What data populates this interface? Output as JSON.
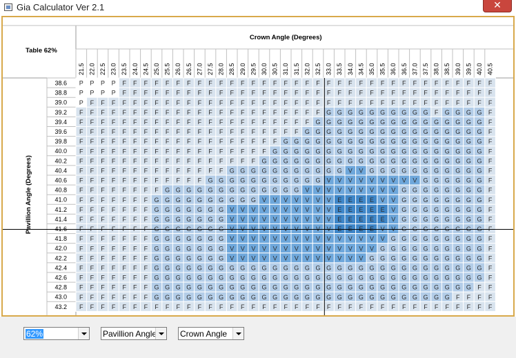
{
  "window": {
    "title": "Gia Calculator Ver 2.1",
    "close_glyph": "✕"
  },
  "table": {
    "corner_label": "Table 62%",
    "x_axis_title": "Crown Angle (Degrees)",
    "y_axis_title": "Pavillion Angle (Degrees)",
    "crown_angles": [
      "21.5",
      "22.0",
      "22.5",
      "23.0",
      "23.5",
      "24.0",
      "24.5",
      "25.0",
      "25.5",
      "26.0",
      "26.5",
      "27.0",
      "27.5",
      "28.0",
      "28.5",
      "29.0",
      "29.5",
      "30.0",
      "30.5",
      "31.0",
      "31.5",
      "32.0",
      "32.5",
      "33.0",
      "33.5",
      "34.0",
      "34.5",
      "35.0",
      "35.5",
      "36.0",
      "36.5",
      "37.0",
      "37.5",
      "38.0",
      "38.5",
      "39.0",
      "39.5",
      "40.0",
      "40.5"
    ],
    "pavilion_angles": [
      "38.6",
      "38.8",
      "39.0",
      "39.2",
      "39.4",
      "39.6",
      "39.8",
      "40.0",
      "40.2",
      "40.4",
      "40.6",
      "40.8",
      "41.0",
      "41.2",
      "41.4",
      "41.6",
      "41.8",
      "42.0",
      "42.2",
      "42.4",
      "42.6",
      "42.8",
      "43.0",
      "43.2"
    ],
    "grades": [
      "PPPPFFFFFFFFFFFFFFFFFFFFFFFFFFFFFFFFFFF",
      "PPPPFFFFFFFFFFFFFFFFFFFFFFFFFFFFFFFFFFF",
      "PFFFFFFFFFFFFFFFFFFFFFFFFFFFFFFFFFFFFFF",
      "FFFFFFFFFFFFFFFFFFFFFFFGGGGGGGGGGFGGGGF",
      "FFFFFFFFFFFFFFFFFFFFFFGGGGGGGGGGGGGGGGF",
      "FFFFFFFFFFFFFFFFFFFFFGGGGGGGGGGGGGGGGGF",
      "FFFFFFFFFFFFFFFFFFFGGGGGGGGGGGGGGGGGGGF",
      "FFFFFFFFFFFFFFFFFFGGGGGGGGGGGGGGGGGGGGF",
      "FFFFFFFFFFFFFFFFFGGGGGGGGGGGGGGGGGGGGGF",
      "FFFFFFFFFFFFFFGGGGGGGGGGGVVGGGGGGGGGGGF",
      "FFFFFFFFFFFFGGGGGGGGGGGVVVVVVVVVGGGGGGF",
      "FFFFFFFFGGGGGGGGGGGGGVVVVVVVVVGGGGGGGGF",
      "FFFFFFFGGGGGGGGGGVVVVVVVEEEEVVGGGGGGGGF",
      "FFFFFFFGGGGGGGVVVVVVVVVVEEEEEVGGGGGGGGF",
      "FFFFFFFGGGGGGGVVVVVVVVVVEEEEEVGGGGGGGGF",
      "FFFFFFFGGGGGGGVVVVVVVVVVEEEEVVGGGGGGGGF",
      "FFFFFFFGGGGGGGVVVVVVVVVVVVVVVGGGGGGGGGF",
      "FFFFFFFGGGGGGGVVVVVVVVVVVVVVGGGGGGGGGGF",
      "FFFFFFFGGGGGGGVVVVVVVVVVVVVGGGGGGGGGGGF",
      "FFFFFFFGGGGGGGGGGGGGGGGGGGGGGGGGGGGGGGF",
      "FFFFFFFGGGGGGGGGGGGGGGGGGGGGGGGGGGGGGGF",
      "FFFFFFFGGGGGGGGGGGGGGGGGGGGGGGGGGGGGGFF",
      "FFFFFFFGGGGGGGGGGGGGGGGGGGGGGGGGGGGFFFF",
      "FFFFFFFFFFFFFFFFFFFFFFFFFFFFFFFFFFFFFFF"
    ],
    "grade_colors": {
      "P": "#ffffff",
      "F": "#d8e3ee",
      "G": "#b3cde8",
      "V": "#6ea7db",
      "E": "#3e86c8"
    },
    "crosshair_color": "#000000",
    "selected_crown": "33.0",
    "selected_pavilion": "41.6"
  },
  "controls": {
    "table_select": {
      "value": "62%"
    },
    "pavilion_select": {
      "value": "Pavillion Angle"
    },
    "crown_select": {
      "value": "Crown Angle"
    }
  }
}
